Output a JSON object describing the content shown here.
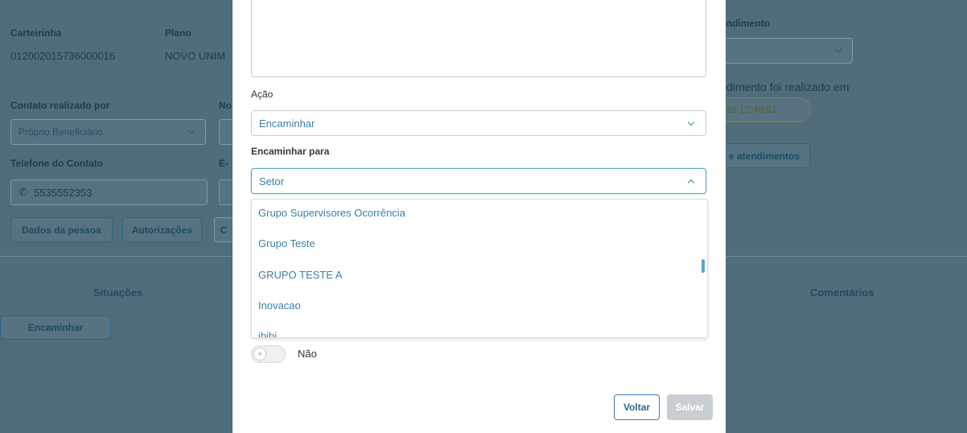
{
  "background": {
    "carteirinha_label": "Carteirinha",
    "carteirinha_value": "012002015736000016",
    "plano_label": "Plano",
    "plano_value": "NOVO UNIM",
    "atendimento_label": "ndimento",
    "atendimento_info": "dimento foi realizado em",
    "atendimento_time": "às 12:48:51",
    "atendimentos_button": "e atendimentos",
    "contato_label": "Contato realizado por",
    "contato_value": "Próprio Beneficiário",
    "no_label": "No",
    "telefone_label": "Telefone do Contato",
    "telefone_value": "5535552353",
    "e_label": "E-",
    "dados_button": "Dados da pessoa",
    "autorizacoes_button": "Autorizações",
    "extra_button": "C",
    "situacoes_title": "Situações",
    "encaminhar_button": "Encaminhar",
    "comentarios_title": "Comentários"
  },
  "modal": {
    "acao_label": "Ação",
    "acao_value": "Encaminhar",
    "encaminhar_para_label": "Encaminhar para",
    "setor_value": "Setor",
    "options": [
      "Grupo Supervisores Ocorrência",
      "Grupo Teste",
      "GRUPO TESTE A",
      "Inovacao",
      "ibibi"
    ],
    "switch_label": "Não",
    "switch_icon": "×",
    "voltar_button": "Voltar",
    "salvar_button": "Salvar"
  }
}
